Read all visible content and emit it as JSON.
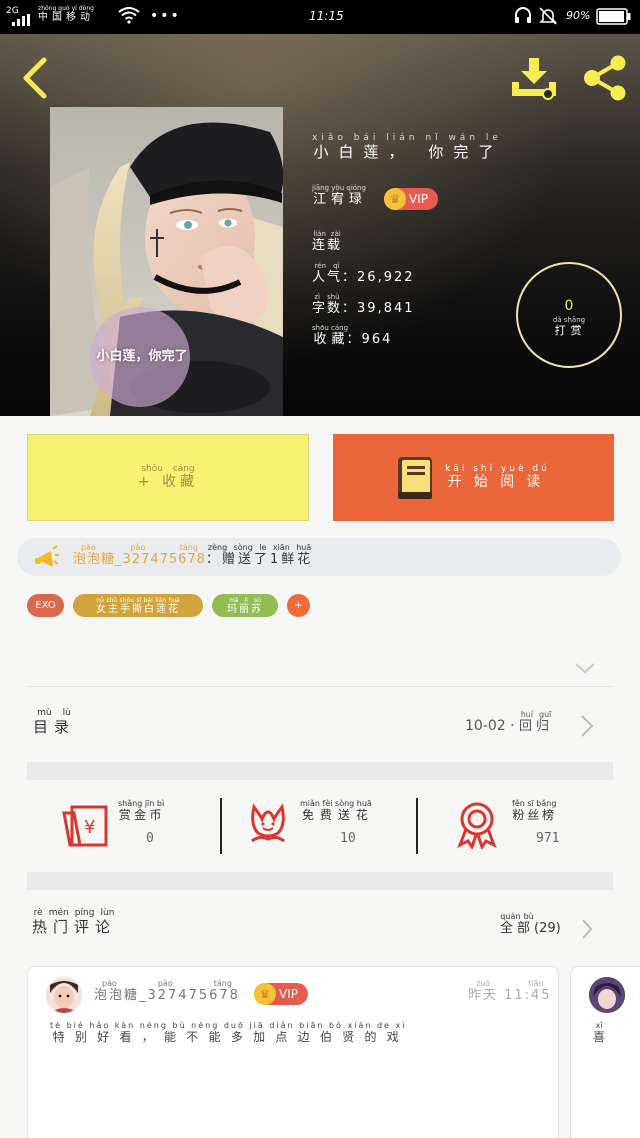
{
  "status_bar": {
    "network": "2G",
    "carrier": "中国移动",
    "carrier_pinyin": "zhōng guó yí dòng",
    "time": "11:15",
    "battery": "90%",
    "icons": [
      "signal-icon",
      "wifi-icon",
      "more-dots-icon",
      "headset-icon",
      "bell-muted-icon",
      "battery-icon"
    ]
  },
  "header": {
    "back_icon": "chevron-left-icon",
    "download_icon": "download-icon",
    "share_icon": "share-icon"
  },
  "book": {
    "cover_caption": "小白莲，你完了",
    "title": "小白莲， 你完了",
    "title_pinyin": "xiǎo bái lián    nǐ wán le",
    "author": "江宥琭",
    "author_pinyin": "jiāng yòu qióng",
    "vip_label": "VIP",
    "status": "连载",
    "status_pinyin": "lián zài",
    "popularity_label": "人气",
    "popularity_pinyin": "rén qì",
    "popularity_value": "26,922",
    "word_count_label": "字数",
    "word_count_pinyin": "zì shù",
    "word_count_value": "39,841",
    "favorites_label": "收藏",
    "favorites_pinyin": "shōu cáng",
    "favorites_value": "964",
    "reward_count": "0",
    "reward_label": "打赏",
    "reward_pinyin": "dǎ shǎng"
  },
  "actions": {
    "collect_label": "+ 收藏",
    "collect_pinyin": "shōu cáng",
    "read_label": "开始阅读",
    "read_pinyin": "kāi shǐ yuè dú"
  },
  "gift_ticker": {
    "user": "泡泡糖_327475678",
    "user_pinyin": "pào pào táng",
    "message": "：赠送了1鲜花",
    "message_pinyin": "zèng sòng le  xiān huā"
  },
  "tags": [
    {
      "label": "EXO",
      "pinyin": "",
      "color": "#d9694d"
    },
    {
      "label": "女主手撕白莲花",
      "pinyin": "nǚ zhǔ shǒu sī bái lián huā",
      "color": "#d2a23b"
    },
    {
      "label": "玛丽苏",
      "pinyin": "mǎ lì sū",
      "color": "#92bd55"
    },
    {
      "label": "+",
      "pinyin": "",
      "color": "#ef6b3c"
    }
  ],
  "catalog": {
    "label": "目录",
    "pinyin": "mù lù",
    "latest_date": "10-02",
    "latest_title": "回归",
    "latest_pinyin": "huí guī"
  },
  "stats": [
    {
      "label": "赏金币",
      "pinyin": "shǎng jīn bì",
      "value": "0",
      "icon": "red-envelope-icon"
    },
    {
      "label": "免费送花",
      "pinyin": "miǎn fèi sòng huā",
      "value": "10",
      "icon": "flower-icon"
    },
    {
      "label": "粉丝榜",
      "pinyin": "fěn sī bǎng",
      "value": "971",
      "icon": "medal-icon"
    }
  ],
  "comments_section": {
    "title": "热门评论",
    "title_pinyin": "rè mén píng lùn",
    "all_label": "全部",
    "all_pinyin": "quán bù",
    "all_count": "(29)"
  },
  "comments": [
    {
      "user": "泡泡糖_327475678",
      "user_pinyin": "pào pào táng",
      "vip": "VIP",
      "time": "昨天 11:45",
      "time_pinyin": "zuó tiān",
      "text": "特别好看，能不能多加点边伯贤的戏",
      "text_pinyin": "tè bié hǎo kàn   néng bù néng duō jiā diǎn biān bó xián de xì"
    },
    {
      "text": "喜",
      "text_pinyin": "xǐ"
    }
  ]
}
